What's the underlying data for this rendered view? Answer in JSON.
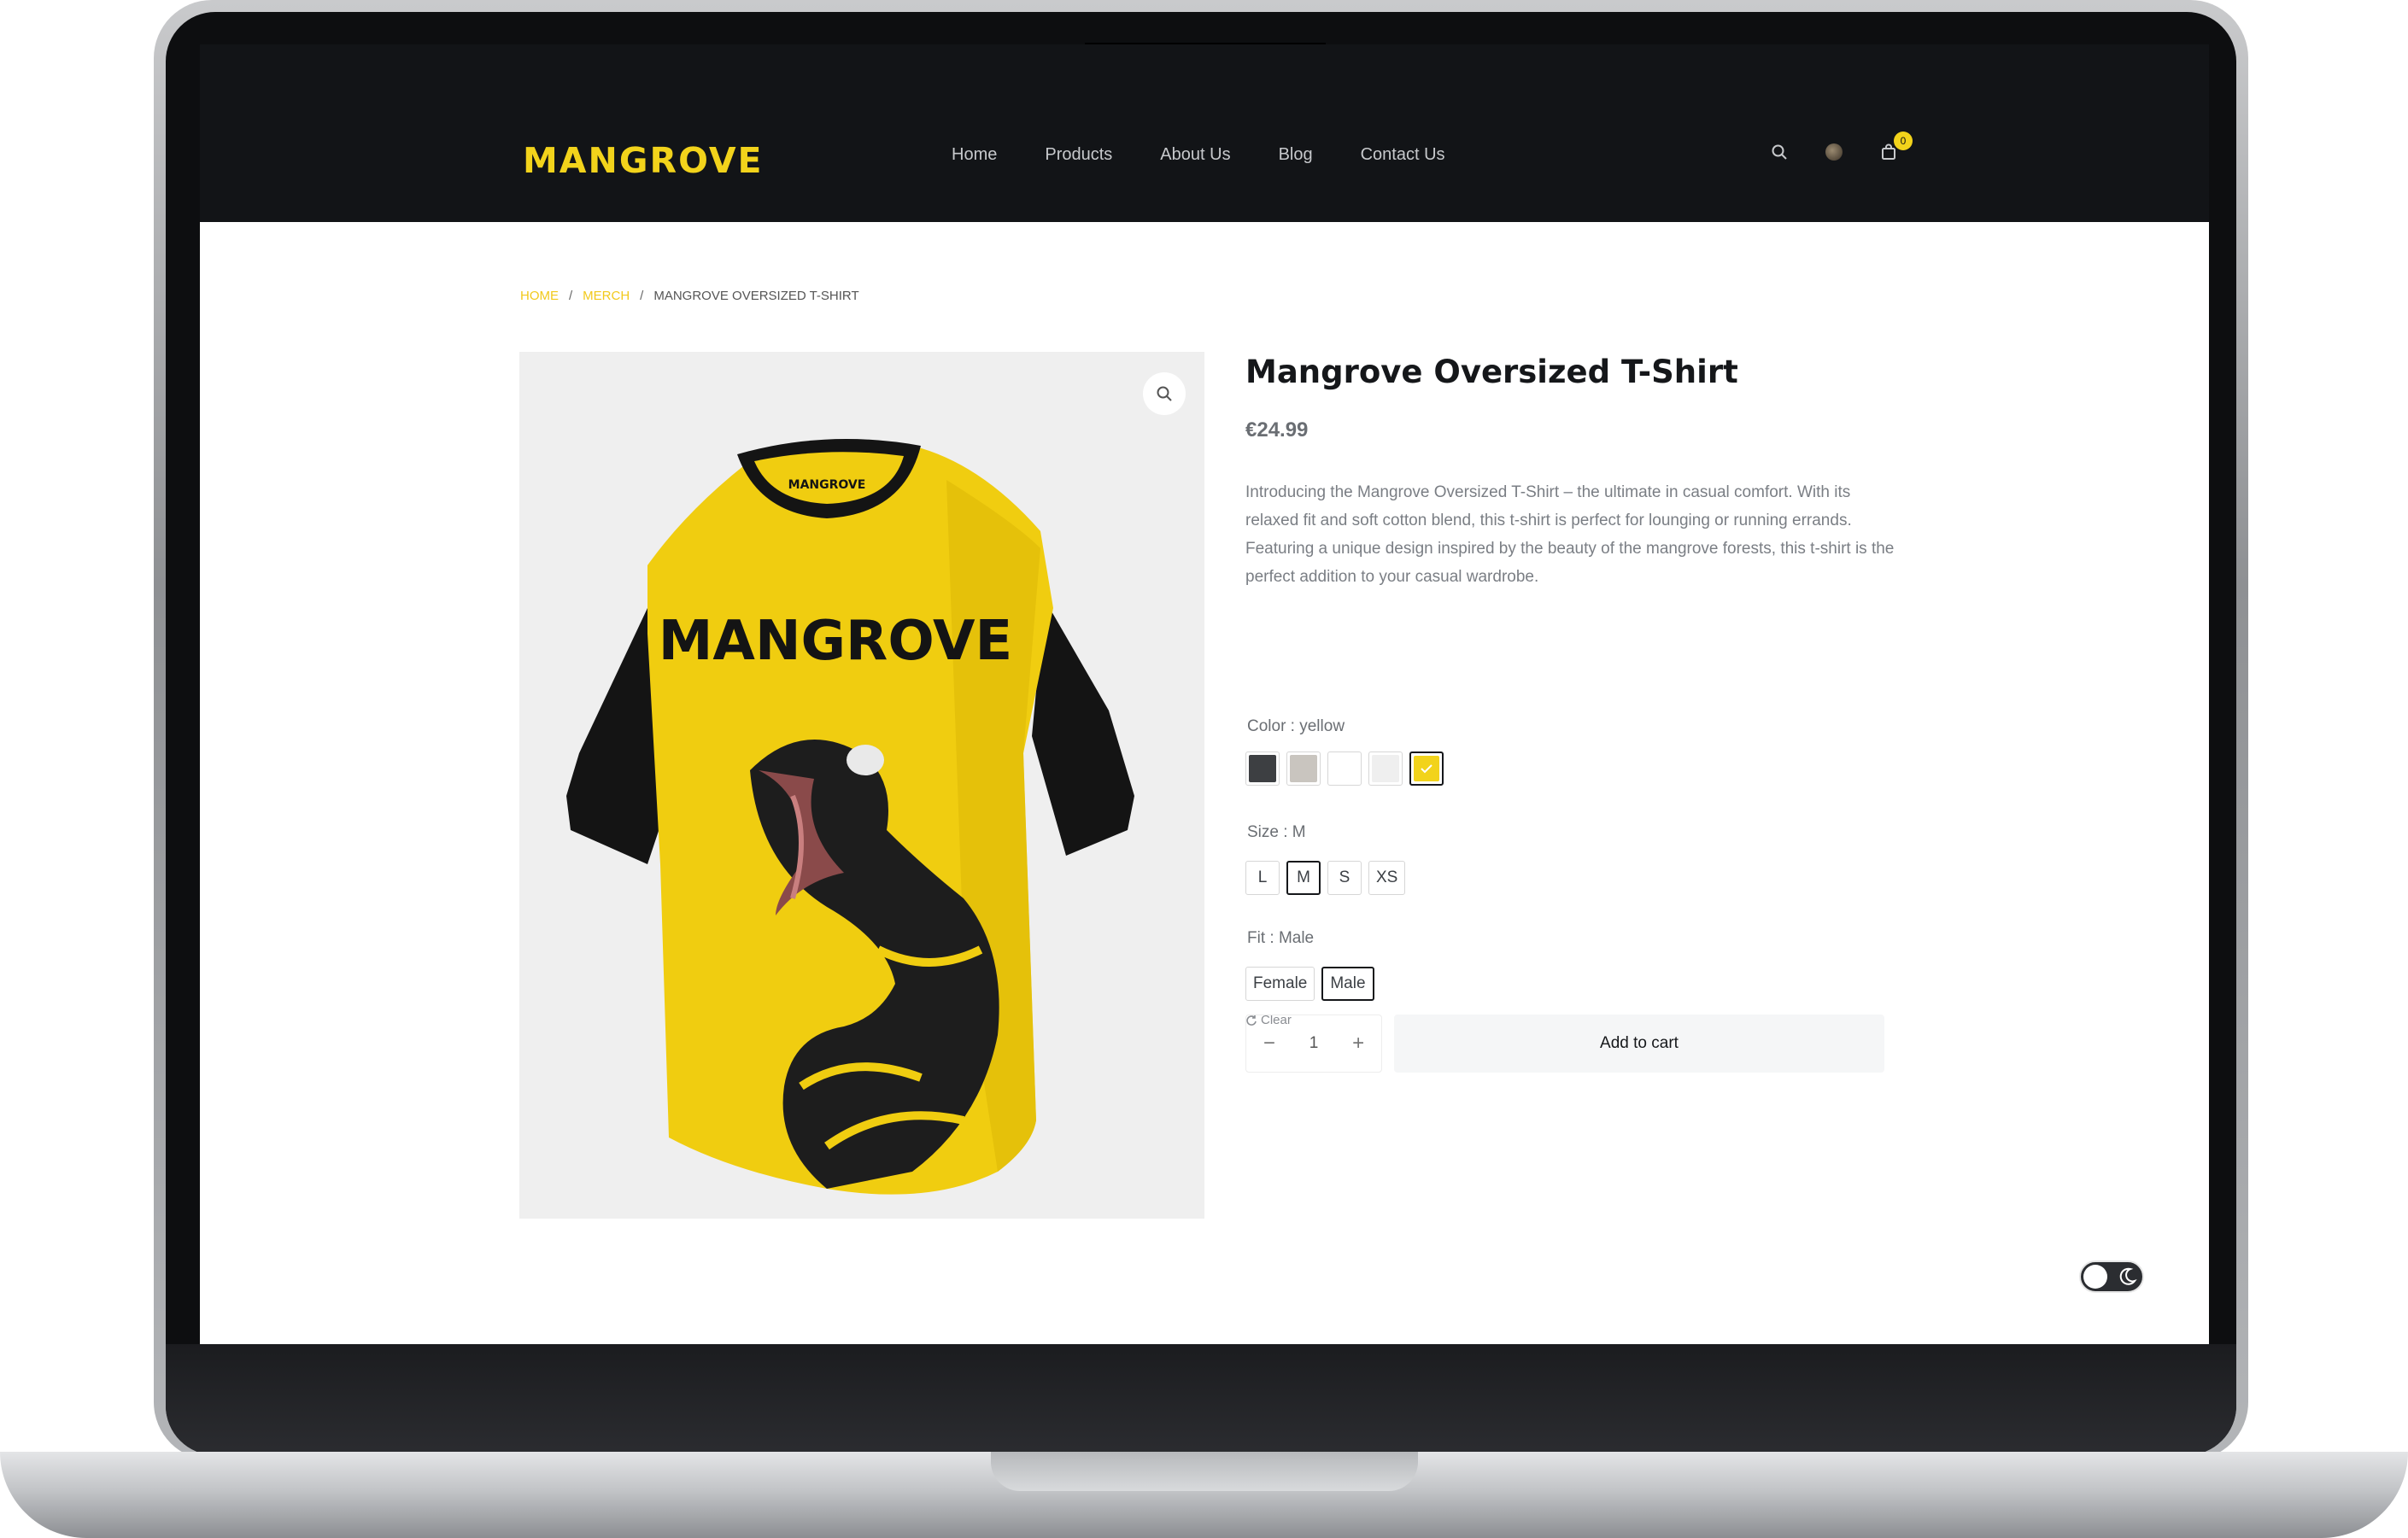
{
  "brand": {
    "logo_text": "MANGROVE",
    "accent": "#f2d31b"
  },
  "nav": {
    "items": [
      "Home",
      "Products",
      "About Us",
      "Blog",
      "Contact Us"
    ]
  },
  "header_icons": {
    "search": "search-icon",
    "account": "avatar",
    "cart": "bag-icon",
    "cart_count": "0"
  },
  "breadcrumb": {
    "home": "HOME",
    "category": "MERCH",
    "current": "MANGROVE OVERSIZED T-SHIRT"
  },
  "product": {
    "title": "Mangrove Oversized T-Shirt",
    "price": "€24.99",
    "description": "Introducing the Mangrove Oversized T-Shirt – the ultimate in casual comfort. With its relaxed fit and soft cotton blend, this t-shirt is perfect for lounging or running errands. Featuring a unique design inspired by the beauty of the mangrove forests, this t-shirt is the perfect addition to your casual wardrobe.",
    "image_text": "MANGROVE",
    "collar_text": "MANGROVE"
  },
  "color": {
    "label": "Color : yellow",
    "swatches": [
      "#3d3f42",
      "#c9c5bf",
      "#ffffff",
      "#efefef",
      "#f2d31b"
    ],
    "selected_index": 4
  },
  "size": {
    "label": "Size : M",
    "options": [
      "L",
      "M",
      "S",
      "XS"
    ],
    "selected": "M"
  },
  "fit": {
    "label": "Fit : Male",
    "options": [
      "Female",
      "Male"
    ],
    "selected": "Male"
  },
  "clear_label": "Clear",
  "quantity": {
    "minus": "−",
    "value": "1",
    "plus": "+"
  },
  "add_to_cart": "Add to cart",
  "theme_toggle": {
    "mode": "dark-mode"
  }
}
